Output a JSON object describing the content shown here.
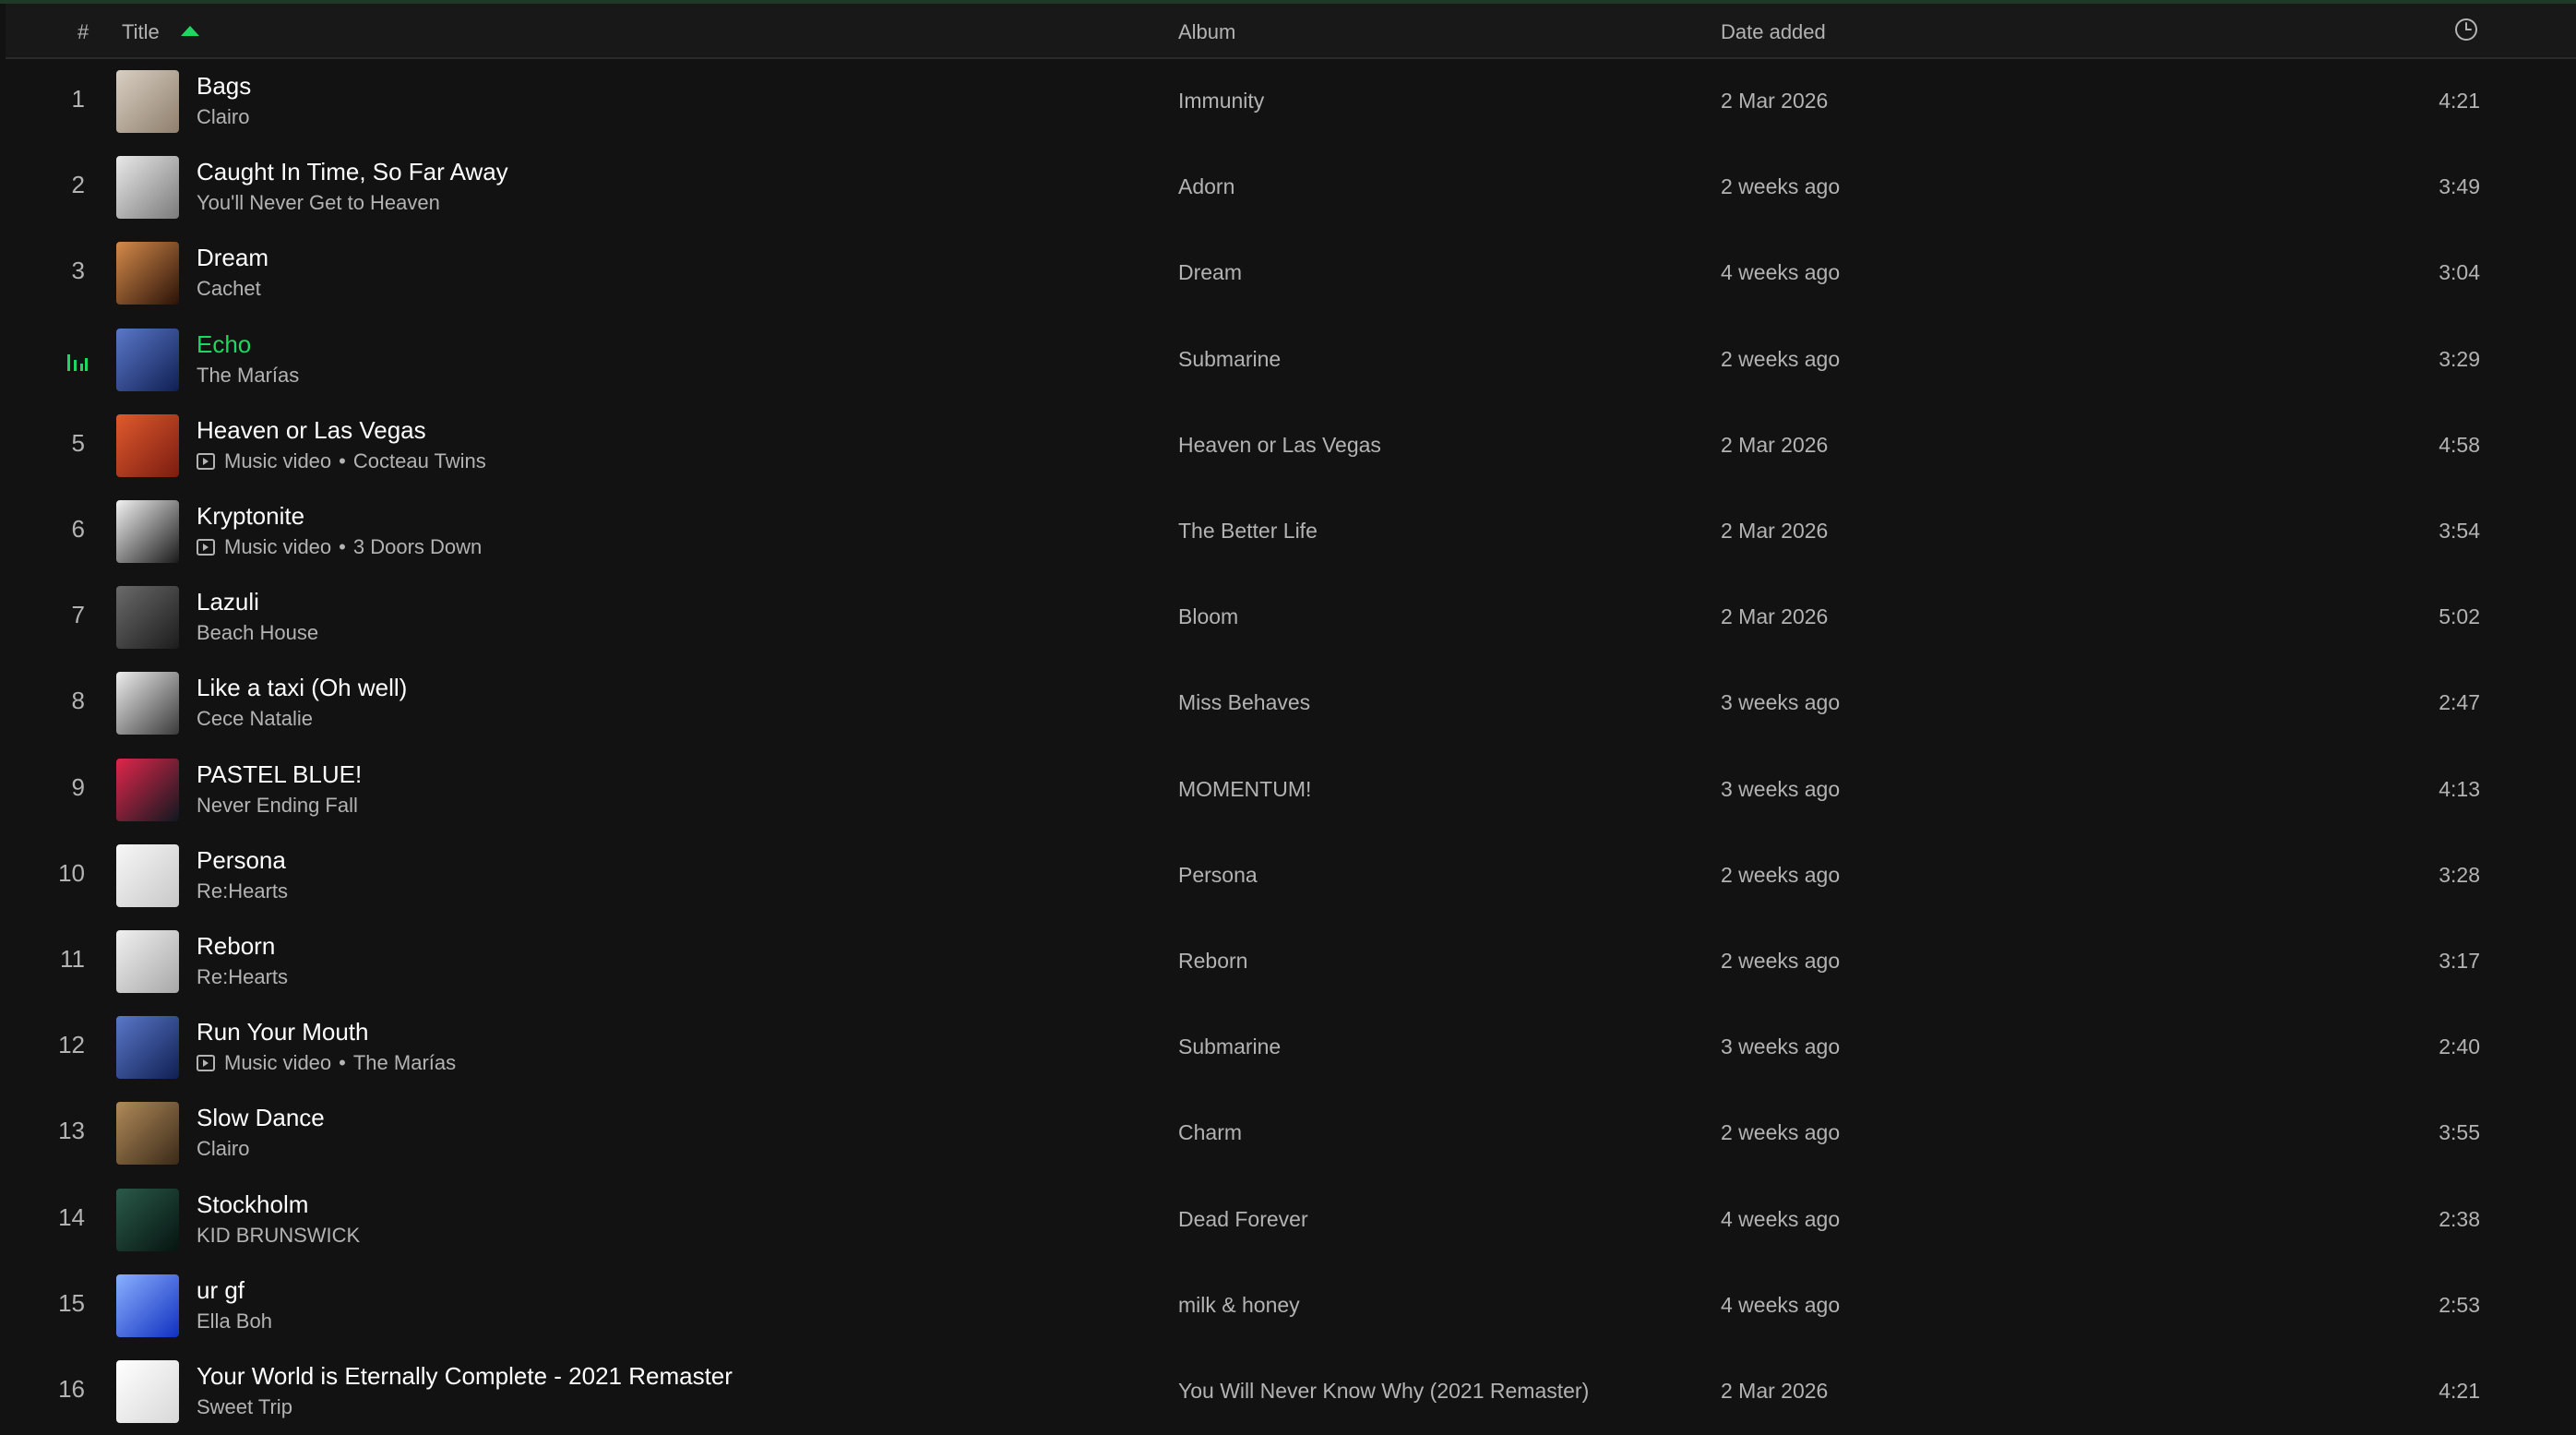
{
  "header": {
    "num_label": "#",
    "title_label": "Title",
    "album_label": "Album",
    "date_label": "Date added",
    "sort_icon": "sort-ascending-icon",
    "duration_icon": "clock-icon",
    "accent_color": "#1ed760"
  },
  "tracks": [
    {
      "index": "1",
      "title": "Bags",
      "artist": "Clairo",
      "music_video": false,
      "album": "Immunity",
      "date_added": "2 Mar 2026",
      "duration": "4:21",
      "thumb": [
        "#d8cfc2",
        "#8f7f6d"
      ]
    },
    {
      "index": "2",
      "title": "Caught In Time, So Far Away",
      "artist": "You'll Never Get to Heaven",
      "music_video": false,
      "album": "Adorn",
      "date_added": "2 weeks ago",
      "duration": "3:49",
      "thumb": [
        "#e9e9e9",
        "#7a7a7a"
      ]
    },
    {
      "index": "3",
      "title": "Dream",
      "artist": "Cachet",
      "music_video": false,
      "album": "Dream",
      "date_added": "4 weeks ago",
      "duration": "3:04",
      "thumb": [
        "#d48a4a",
        "#2a1208"
      ]
    },
    {
      "index": "",
      "title": "Echo",
      "artist": "The Marías",
      "music_video": false,
      "album": "Submarine",
      "date_added": "2 weeks ago",
      "duration": "3:29",
      "thumb": [
        "#5a78c8",
        "#0f1f52"
      ],
      "playing": true
    },
    {
      "index": "5",
      "title": "Heaven or Las Vegas",
      "artist": "Cocteau Twins",
      "music_video": true,
      "music_video_label": "Music video",
      "album": "Heaven or Las Vegas",
      "date_added": "2 Mar 2026",
      "duration": "4:58",
      "thumb": [
        "#e05a2e",
        "#7a1c10"
      ]
    },
    {
      "index": "6",
      "title": "Kryptonite",
      "artist": "3 Doors Down",
      "music_video": true,
      "music_video_label": "Music video",
      "album": "The Better Life",
      "date_added": "2 Mar 2026",
      "duration": "3:54",
      "thumb": [
        "#f2f2f2",
        "#1a1a1a"
      ]
    },
    {
      "index": "7",
      "title": "Lazuli",
      "artist": "Beach House",
      "music_video": false,
      "album": "Bloom",
      "date_added": "2 Mar 2026",
      "duration": "5:02",
      "thumb": [
        "#6a6a6a",
        "#1c1c1c"
      ]
    },
    {
      "index": "8",
      "title": "Like a taxi (Oh well)",
      "artist": "Cece Natalie",
      "music_video": false,
      "album": "Miss Behaves",
      "date_added": "3 weeks ago",
      "duration": "2:47",
      "thumb": [
        "#ededed",
        "#3a3a3a"
      ]
    },
    {
      "index": "9",
      "title": "PASTEL BLUE!",
      "artist": "Never Ending Fall",
      "music_video": false,
      "album": "MOMENTUM!",
      "date_added": "3 weeks ago",
      "duration": "4:13",
      "thumb": [
        "#e0264a",
        "#101820"
      ]
    },
    {
      "index": "10",
      "title": "Persona",
      "artist": "Re:Hearts",
      "music_video": false,
      "album": "Persona",
      "date_added": "2 weeks ago",
      "duration": "3:28",
      "thumb": [
        "#f7f7f7",
        "#c8c8c8"
      ]
    },
    {
      "index": "11",
      "title": "Reborn",
      "artist": "Re:Hearts",
      "music_video": false,
      "album": "Reborn",
      "date_added": "2 weeks ago",
      "duration": "3:17",
      "thumb": [
        "#f0f0f0",
        "#a8a8a8"
      ]
    },
    {
      "index": "12",
      "title": "Run Your Mouth",
      "artist": "The Marías",
      "music_video": true,
      "music_video_label": "Music video",
      "album": "Submarine",
      "date_added": "3 weeks ago",
      "duration": "2:40",
      "thumb": [
        "#5a78c8",
        "#0f1f52"
      ]
    },
    {
      "index": "13",
      "title": "Slow Dance",
      "artist": "Clairo",
      "music_video": false,
      "album": "Charm",
      "date_added": "2 weeks ago",
      "duration": "3:55",
      "thumb": [
        "#b08a5a",
        "#3a2a18"
      ]
    },
    {
      "index": "14",
      "title": "Stockholm",
      "artist": "KID BRUNSWICK",
      "music_video": false,
      "album": "Dead Forever",
      "date_added": "4 weeks ago",
      "duration": "2:38",
      "thumb": [
        "#2a5a4a",
        "#061410"
      ]
    },
    {
      "index": "15",
      "title": "ur gf",
      "artist": "Ella Boh",
      "music_video": false,
      "album": "milk & honey",
      "date_added": "4 weeks ago",
      "duration": "2:53",
      "thumb": [
        "#8ab0ff",
        "#1030c0"
      ]
    },
    {
      "index": "16",
      "title": "Your World is Eternally Complete - 2021 Remaster",
      "artist": "Sweet Trip",
      "music_video": false,
      "album": "You Will Never Know Why (2021 Remaster)",
      "date_added": "2 Mar 2026",
      "duration": "4:21",
      "thumb": [
        "#ffffff",
        "#d8d8d8"
      ]
    }
  ]
}
